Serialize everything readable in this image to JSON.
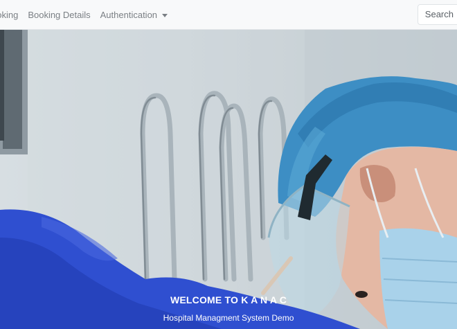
{
  "navbar": {
    "links": [
      {
        "label": "ooking"
      },
      {
        "label": "Booking Details"
      },
      {
        "label": "Authentication"
      }
    ],
    "search_label": "Search"
  },
  "hero": {
    "title": "WELCOME TO K A N A C",
    "subtitle": "Hospital Managment System Demo"
  },
  "colors": {
    "navbar_bg": "#f8f9fa",
    "scrub_blue": "#2f4fd0",
    "cap_blue": "#3d8ec4"
  }
}
